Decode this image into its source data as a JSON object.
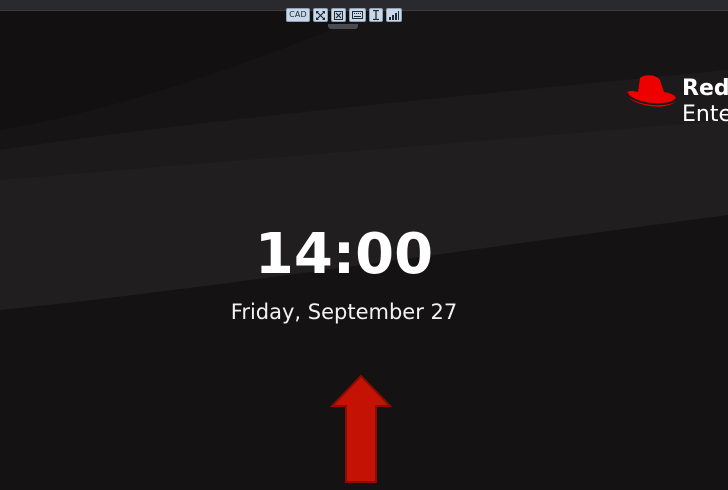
{
  "toolbar": {
    "cad_label": "CAD",
    "buttons": [
      {
        "name": "fullscreen-icon"
      },
      {
        "name": "scale-icon"
      },
      {
        "name": "keyboard-icon"
      },
      {
        "name": "text-cursor-icon"
      },
      {
        "name": "signal-icon"
      }
    ]
  },
  "brand": {
    "line1": "Red",
    "line2": "Ente",
    "accent": "#ee0000"
  },
  "lock_screen": {
    "time": "14:00",
    "date": "Friday, September 27"
  },
  "annotation": {
    "arrow_color": "#cc1100",
    "arrow_icon": "up-arrow-icon"
  }
}
